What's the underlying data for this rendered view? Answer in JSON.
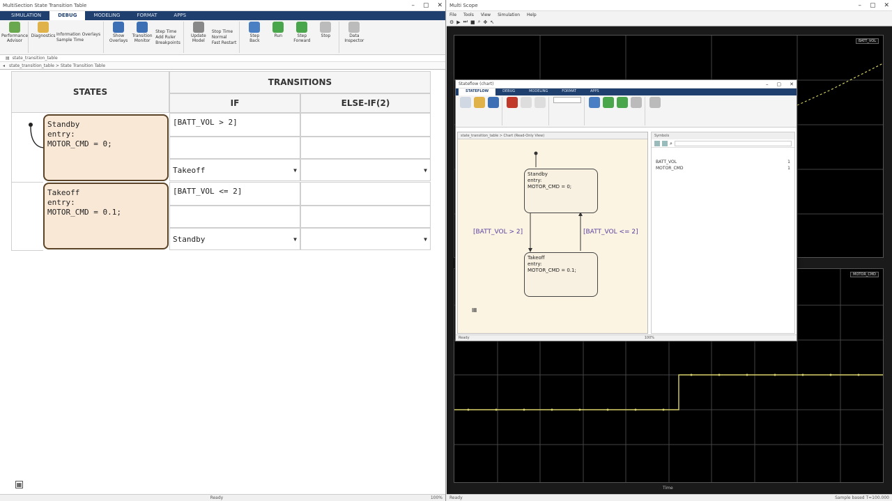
{
  "left": {
    "title": "MultiSection State Transition Table",
    "tabs": [
      "SIMULATION",
      "DEBUG",
      "MODELING",
      "FORMAT",
      "APPS"
    ],
    "active_tab": "DEBUG",
    "ribbon": {
      "groups": [
        {
          "label": "",
          "buttons": [
            "Performance Advisor"
          ]
        },
        {
          "label": "",
          "buttons": [
            "Diagnostics"
          ],
          "small": [
            "Information Overlays",
            "Sample Time"
          ]
        },
        {
          "label": "",
          "buttons": [
            "Show Overlays",
            "Transition Monitor"
          ],
          "small": [
            "Step Time",
            "Add Ruler",
            "Breakpoints"
          ]
        },
        {
          "label": "",
          "buttons": [
            "Update Model"
          ],
          "small": [
            "Stop Time",
            "Normal",
            "Fast Restart"
          ]
        },
        {
          "label": "",
          "buttons": [
            "Step Back",
            "Run",
            "Step Forward",
            "Stop"
          ]
        },
        {
          "label": "",
          "buttons": [
            "Data Inspector"
          ]
        }
      ]
    },
    "address": "state_transition_table",
    "breadcrumb": "state_transition_table > State Transition Table",
    "table": {
      "states_header": "STATES",
      "transitions_header": "TRANSITIONS",
      "if_header": "IF",
      "elseif_header": "ELSE-IF(2)",
      "rows": [
        {
          "state_text": [
            "Standby",
            "entry:",
            "MOTOR_CMD = 0;"
          ],
          "if_condition": "[BATT_VOL > 2]",
          "if_action": "",
          "if_destination": "Takeoff"
        },
        {
          "state_text": [
            "Takeoff",
            "entry:",
            "MOTOR_CMD = 0.1;"
          ],
          "if_condition": "[BATT_VOL <= 2]",
          "if_action": "",
          "if_destination": "Standby"
        }
      ]
    },
    "status": "Ready",
    "status_right": "100%"
  },
  "scope": {
    "title": "Multi Scope",
    "menu": [
      "File",
      "Tools",
      "View",
      "Simulation",
      "Help"
    ],
    "toolbar_icons": [
      "settings-icon",
      "play-icon",
      "step-icon",
      "stop-icon",
      "zoom-icon",
      "pan-icon",
      "cursor-icon"
    ],
    "top_legend": "BATT_VOL",
    "bottom_legend": "MOTOR_CMD",
    "status_left": "Ready",
    "status_right": "Sample based  T=100.000",
    "xlabel": "Time"
  },
  "chart_win": {
    "title": "Stateflow (chart)",
    "tabs": [
      "STATEFLOW",
      "DEBUG",
      "MODELING",
      "FORMAT",
      "APPS"
    ],
    "active_tab": "STATEFLOW",
    "canvas_breadcrumb": "state_transition_table > Chart (Read-Only View)",
    "symbols_header": "Symbols",
    "symbols": [
      {
        "name": "BATT_VOL",
        "value": "1"
      },
      {
        "name": "MOTOR_CMD",
        "value": "1"
      }
    ],
    "standby": [
      "Standby",
      "entry:",
      "MOTOR_CMD = 0;"
    ],
    "takeoff": [
      "Takeoff",
      "entry:",
      "MOTOR_CMD = 0.1;"
    ],
    "trans_down": "[BATT_VOL > 2]",
    "trans_up": "[BATT_VOL <= 2]",
    "status": "Ready",
    "zoom": "100%"
  }
}
